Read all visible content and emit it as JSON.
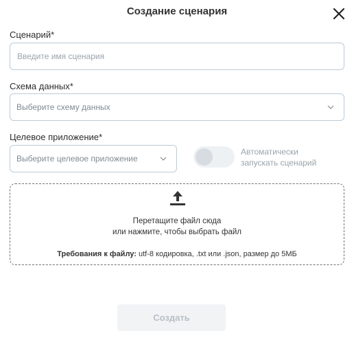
{
  "dialog": {
    "title": "Создание сценария"
  },
  "form": {
    "scenario": {
      "label": "Сценарий*",
      "placeholder": "Введите имя сценария",
      "value": ""
    },
    "schema": {
      "label": "Схема данных*",
      "placeholder": "Выберите схему данных"
    },
    "target_app": {
      "label": "Целевое приложение*",
      "placeholder": "Выберите целевое приложение"
    },
    "autorun": {
      "label_line1": "Автоматически",
      "label_line2": "запускать сценарий",
      "enabled": false
    }
  },
  "upload": {
    "icon": "upload-icon",
    "line1": "Перетащите файл сюда",
    "line2": "или нажмите, чтобы выбрать файл",
    "requirements_label": "Требования к файлу:",
    "requirements_text": " utf-8 кодировка, .txt или .json, размер до 5МБ"
  },
  "actions": {
    "create_label": "Создать"
  },
  "colors": {
    "border": "#b9cbd8",
    "disabled_button_bg": "#f1f3f5",
    "disabled_text": "#b9c0c6"
  }
}
